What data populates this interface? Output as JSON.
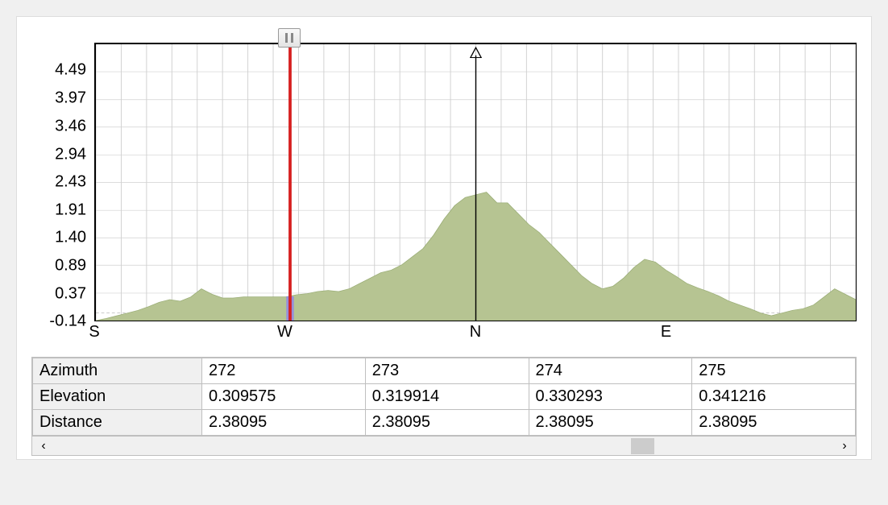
{
  "chart_data": {
    "type": "area",
    "title": "",
    "xlabel": "",
    "ylabel": "",
    "ylim": [
      -0.14,
      5.0
    ],
    "xlim": [
      180,
      540
    ],
    "y_ticks": [
      -0.14,
      0.37,
      0.89,
      1.4,
      1.91,
      2.43,
      2.94,
      3.46,
      3.97,
      4.49
    ],
    "x_ticks": [
      {
        "x": 180,
        "label": "S"
      },
      {
        "x": 270,
        "label": "W"
      },
      {
        "x": 360,
        "label": "N"
      },
      {
        "x": 450,
        "label": "E"
      }
    ],
    "cursor_x": 272,
    "north_marker_x": 360,
    "series": [
      {
        "name": "elevation-profile",
        "x": [
          180,
          185,
          190,
          195,
          200,
          205,
          210,
          215,
          220,
          225,
          230,
          235,
          240,
          245,
          250,
          255,
          260,
          265,
          270,
          275,
          280,
          285,
          290,
          295,
          300,
          305,
          310,
          315,
          320,
          325,
          330,
          335,
          340,
          345,
          350,
          355,
          360,
          365,
          370,
          375,
          380,
          385,
          390,
          395,
          400,
          405,
          410,
          415,
          420,
          425,
          430,
          435,
          440,
          445,
          450,
          455,
          460,
          465,
          470,
          475,
          480,
          485,
          490,
          495,
          500,
          505,
          510,
          515,
          520,
          525,
          530,
          535,
          540
        ],
        "values": [
          -0.14,
          -0.1,
          -0.05,
          0.0,
          0.05,
          0.12,
          0.2,
          0.25,
          0.22,
          0.3,
          0.45,
          0.35,
          0.28,
          0.28,
          0.3,
          0.3,
          0.3,
          0.3,
          0.3,
          0.34,
          0.36,
          0.4,
          0.42,
          0.4,
          0.45,
          0.55,
          0.65,
          0.75,
          0.8,
          0.9,
          1.05,
          1.2,
          1.45,
          1.75,
          2.0,
          2.15,
          2.2,
          2.25,
          2.05,
          2.05,
          1.85,
          1.65,
          1.5,
          1.3,
          1.1,
          0.9,
          0.7,
          0.55,
          0.45,
          0.5,
          0.65,
          0.85,
          1.0,
          0.95,
          0.8,
          0.68,
          0.55,
          0.47,
          0.4,
          0.32,
          0.22,
          0.15,
          0.08,
          0.0,
          -0.05,
          0.0,
          0.05,
          0.08,
          0.15,
          0.3,
          0.45,
          0.35,
          0.25
        ]
      }
    ],
    "highlight_band": {
      "x": 272,
      "y0": -0.14,
      "y1": 0.31,
      "color": "#7b6fe0"
    }
  },
  "table": {
    "rows": [
      "Azimuth",
      "Elevation",
      "Distance"
    ],
    "columns": [
      {
        "Azimuth": "272",
        "Elevation": "0.309575",
        "Distance": "2.38095"
      },
      {
        "Azimuth": "273",
        "Elevation": "0.319914",
        "Distance": "2.38095"
      },
      {
        "Azimuth": "274",
        "Elevation": "0.330293",
        "Distance": "2.38095"
      },
      {
        "Azimuth": "275",
        "Elevation": "0.341216",
        "Distance": "2.38095"
      }
    ]
  },
  "scroll": {
    "thumb_left_pct": 74,
    "thumb_width_pct": 3
  },
  "colors": {
    "area_fill": "#b6c492",
    "area_stroke": "#9aad76",
    "cursor": "#d62020",
    "highlight": "#8b7ff2",
    "grid": "#d0d0d0"
  }
}
